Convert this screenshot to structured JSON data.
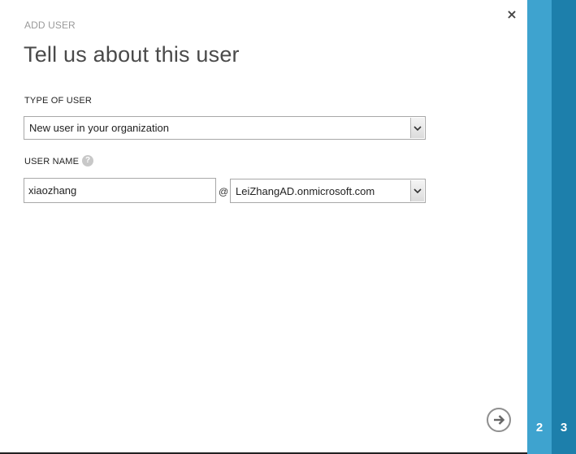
{
  "dialog": {
    "kicker": "ADD USER",
    "title": "Tell us about this user",
    "close_glyph": "×"
  },
  "type_of_user": {
    "label": "TYPE OF USER",
    "selected": "New user in your organization"
  },
  "user_name": {
    "label": "USER NAME",
    "help_glyph": "?",
    "value": "xiaozhang",
    "at_sign": "@",
    "domain_selected": "LeiZhangAD.onmicrosoft.com"
  },
  "steps": [
    {
      "number": "2"
    },
    {
      "number": "3"
    }
  ],
  "colors": {
    "step_rail_current": "#3ea3cf",
    "step_rail_next": "#1d7fab"
  },
  "icons": {
    "close": "close-icon",
    "help": "question-circle-icon",
    "next": "arrow-right-circle-icon",
    "dropdown": "chevron-down-icon"
  }
}
